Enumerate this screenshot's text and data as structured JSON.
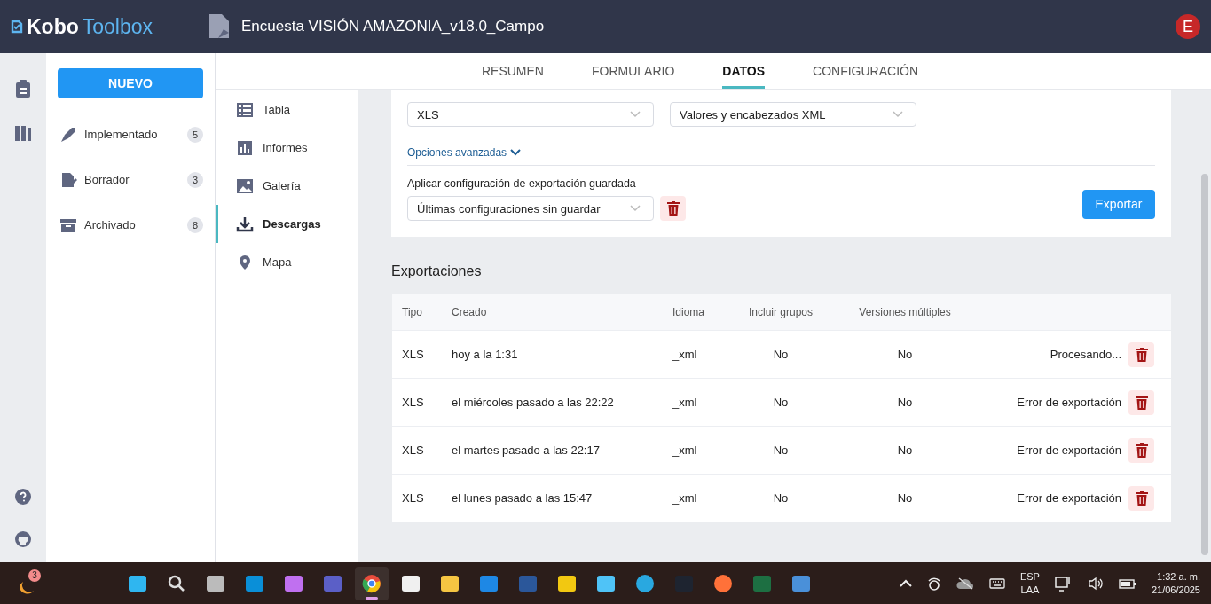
{
  "header": {
    "logo_part_1": "Kobo",
    "logo_part_2": "Toolbox",
    "project_title": "Encuesta VISIÓN AMAZONIA_v18.0_Campo",
    "avatar_letter": "E"
  },
  "sidebar": {
    "new_button": "NUEVO",
    "items": [
      {
        "label": "Implementado",
        "count": "5"
      },
      {
        "label": "Borrador",
        "count": "3"
      },
      {
        "label": "Archivado",
        "count": "8"
      }
    ]
  },
  "tabs": [
    {
      "label": "RESUMEN",
      "selected": false
    },
    {
      "label": "FORMULARIO",
      "selected": false
    },
    {
      "label": "DATOS",
      "selected": true
    },
    {
      "label": "CONFIGURACIÓN",
      "selected": false
    }
  ],
  "subnav": [
    {
      "label": "Tabla",
      "selected": false
    },
    {
      "label": "Informes",
      "selected": false
    },
    {
      "label": "Galería",
      "selected": false
    },
    {
      "label": "Descargas",
      "selected": true
    },
    {
      "label": "Mapa",
      "selected": false
    }
  ],
  "export_form": {
    "export_type": "XLS",
    "value_format": "Valores y encabezados XML",
    "advanced_options": "Opciones avanzadas",
    "saved_config_label": "Aplicar configuración de exportación guardada",
    "saved_config": "Últimas configuraciones sin guardar",
    "export_button": "Exportar"
  },
  "exports": {
    "title": "Exportaciones",
    "columns": [
      "Tipo",
      "Creado",
      "Idioma",
      "Incluir grupos",
      "Versiones múltiples"
    ],
    "rows": [
      {
        "type": "XLS",
        "created": "hoy a la 1:31",
        "language": "_xml",
        "groups": "No",
        "versions": "No",
        "status": "Procesando..."
      },
      {
        "type": "XLS",
        "created": "el miércoles pasado a las 22:22",
        "language": "_xml",
        "groups": "No",
        "versions": "No",
        "status": "Error de exportación"
      },
      {
        "type": "XLS",
        "created": "el martes pasado a las 22:17",
        "language": "_xml",
        "groups": "No",
        "versions": "No",
        "status": "Error de exportación"
      },
      {
        "type": "XLS",
        "created": "el lunes pasado a las 15:47",
        "language": "_xml",
        "groups": "No",
        "versions": "No",
        "status": "Error de exportación"
      }
    ]
  },
  "taskbar": {
    "weather_badge": "3",
    "apps": [
      {
        "selected": false
      },
      {
        "selected": false
      },
      {
        "selected": false
      },
      {
        "selected": false
      },
      {
        "selected": false
      },
      {
        "selected": false
      },
      {
        "selected": true
      },
      {
        "selected": false
      },
      {
        "selected": false
      },
      {
        "selected": false
      },
      {
        "selected": false
      },
      {
        "selected": false
      },
      {
        "selected": false
      },
      {
        "selected": false
      },
      {
        "selected": false
      },
      {
        "selected": false
      },
      {
        "selected": false
      },
      {
        "selected": false
      }
    ],
    "language": "ESP",
    "layout": "LAA",
    "time": "1:32 a. m.",
    "date": "21/06/2025"
  }
}
